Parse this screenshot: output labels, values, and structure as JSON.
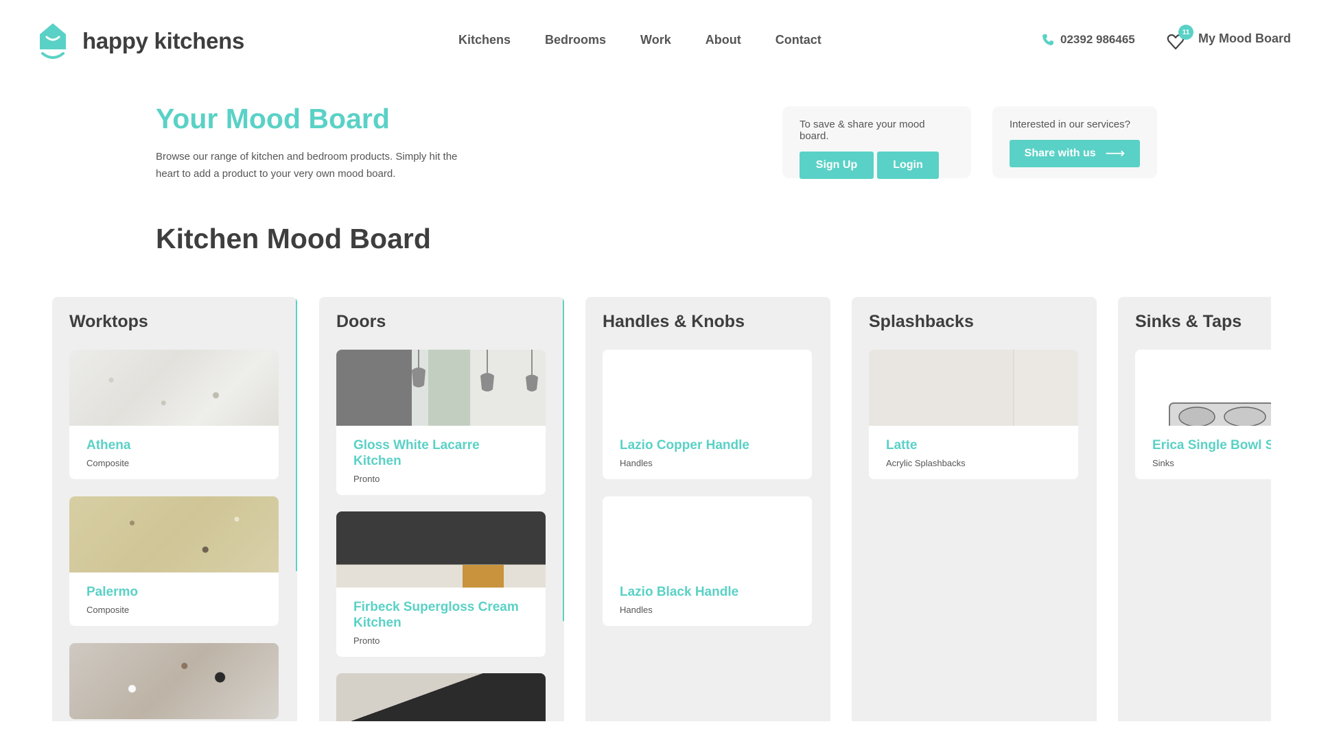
{
  "brand": {
    "name": "happy kitchens",
    "accent": "#5ad1c6"
  },
  "nav": [
    {
      "label": "Kitchens"
    },
    {
      "label": "Bedrooms"
    },
    {
      "label": "Work"
    },
    {
      "label": "About"
    },
    {
      "label": "Contact"
    }
  ],
  "header": {
    "phone": "02392 986465",
    "mood_board_label": "My Mood Board",
    "mood_board_count": "11"
  },
  "intro": {
    "title": "Your Mood Board",
    "text": "Browse our range of kitchen and bedroom products. Simply hit the heart to add a product to your very own mood board."
  },
  "save_panel": {
    "text": "To save & share your mood board.",
    "signup_label": "Sign Up",
    "login_label": "Login"
  },
  "services_panel": {
    "text": "Interested in our services?",
    "share_label": "Share with us"
  },
  "board": {
    "title": "Kitchen Mood Board",
    "columns": [
      {
        "title": "Worktops",
        "items": [
          {
            "name": "Athena",
            "category": "Composite"
          },
          {
            "name": "Palermo",
            "category": "Composite"
          }
        ]
      },
      {
        "title": "Doors",
        "items": [
          {
            "name": "Gloss White Lacarre Kitchen",
            "category": "Pronto"
          },
          {
            "name": "Firbeck Supergloss Cream Kitchen",
            "category": "Pronto"
          }
        ]
      },
      {
        "title": "Handles & Knobs",
        "items": [
          {
            "name": "Lazio Copper Handle",
            "category": "Handles"
          },
          {
            "name": "Lazio Black Handle",
            "category": "Handles"
          }
        ]
      },
      {
        "title": "Splashbacks",
        "items": [
          {
            "name": "Latte",
            "category": "Acrylic Splashbacks"
          }
        ]
      },
      {
        "title": "Sinks & Taps",
        "items": [
          {
            "name": "Erica Single Bowl Si",
            "category": "Sinks"
          }
        ]
      }
    ]
  }
}
